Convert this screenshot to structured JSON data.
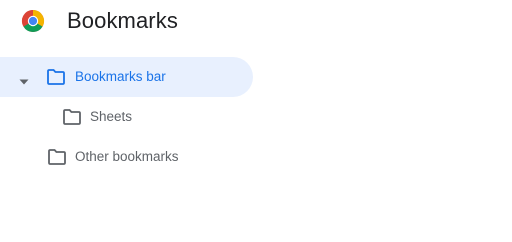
{
  "app": {
    "title": "Bookmarks",
    "logo_icon": "chrome-logo-icon"
  },
  "colors": {
    "selected_bg": "#e8f0fe",
    "selected_text": "#1a73e8",
    "text": "#5f6368",
    "title_text": "#202124"
  },
  "folders": [
    {
      "label": "Bookmarks bar",
      "icon": "folder-icon",
      "expanded": true,
      "selected": true
    },
    {
      "label": "Sheets",
      "icon": "folder-icon",
      "selected": false
    },
    {
      "label": "Other bookmarks",
      "icon": "folder-icon",
      "selected": false
    }
  ]
}
